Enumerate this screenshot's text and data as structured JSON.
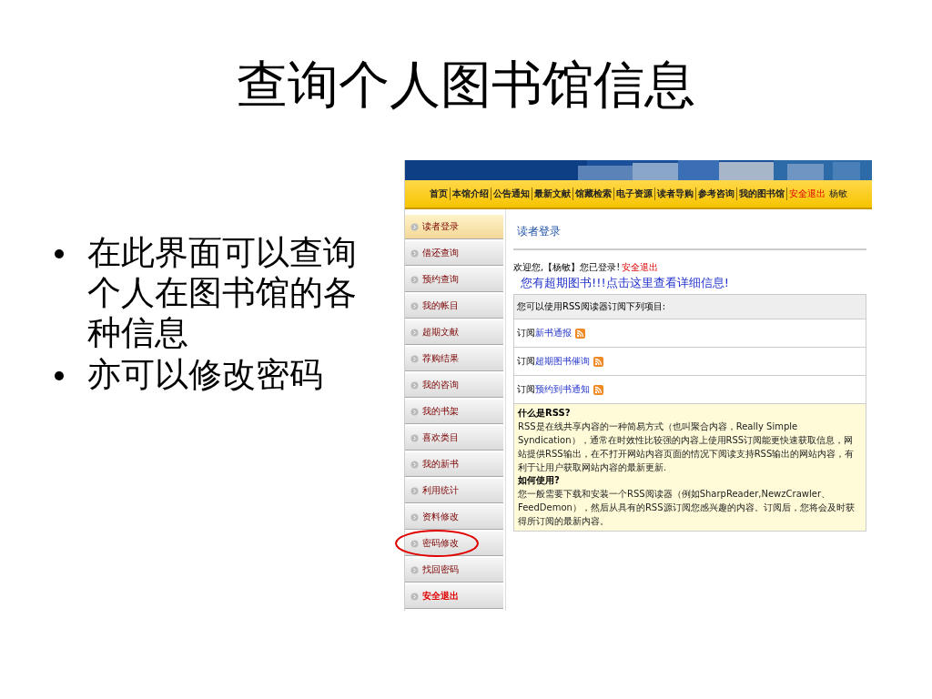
{
  "title": "查询个人图书馆信息",
  "bullets": [
    "在此界面可以查询个人在图书馆的各种信息",
    "亦可以修改密码"
  ],
  "screenshot": {
    "nav": [
      {
        "label": "首页",
        "kind": "link"
      },
      {
        "label": "本馆介绍",
        "kind": "link"
      },
      {
        "label": "公告通知",
        "kind": "link"
      },
      {
        "label": "最新文献",
        "kind": "link"
      },
      {
        "label": "馆藏检索",
        "kind": "link"
      },
      {
        "label": "电子资源",
        "kind": "link"
      },
      {
        "label": "读者导购",
        "kind": "link"
      },
      {
        "label": "参考咨询",
        "kind": "link"
      },
      {
        "label": "我的图书馆",
        "kind": "link"
      },
      {
        "label": "安全退出",
        "kind": "logout"
      },
      {
        "label": "杨敏",
        "kind": "user"
      }
    ],
    "sidebar": [
      {
        "label": "读者登录",
        "selected": true,
        "kind": "normal",
        "circled": false
      },
      {
        "label": "借还查询",
        "selected": false,
        "kind": "normal",
        "circled": false
      },
      {
        "label": "预约查询",
        "selected": false,
        "kind": "normal",
        "circled": false
      },
      {
        "label": "我的帐目",
        "selected": false,
        "kind": "normal",
        "circled": false
      },
      {
        "label": "超期文献",
        "selected": false,
        "kind": "normal",
        "circled": false
      },
      {
        "label": "荐购结果",
        "selected": false,
        "kind": "normal",
        "circled": false
      },
      {
        "label": "我的咨询",
        "selected": false,
        "kind": "normal",
        "circled": false
      },
      {
        "label": "我的书架",
        "selected": false,
        "kind": "normal",
        "circled": false
      },
      {
        "label": "喜欢类目",
        "selected": false,
        "kind": "normal",
        "circled": false
      },
      {
        "label": "我的新书",
        "selected": false,
        "kind": "normal",
        "circled": false
      },
      {
        "label": "利用统计",
        "selected": false,
        "kind": "normal",
        "circled": false
      },
      {
        "label": "资料修改",
        "selected": false,
        "kind": "normal",
        "circled": false
      },
      {
        "label": "密码修改",
        "selected": false,
        "kind": "normal",
        "circled": true
      },
      {
        "label": "找回密码",
        "selected": false,
        "kind": "normal",
        "circled": false
      },
      {
        "label": "安全退出",
        "selected": false,
        "kind": "logout",
        "circled": false
      }
    ],
    "heading": "读者登录",
    "welcome": {
      "text": "欢迎您,【杨敏】您已登录!",
      "logout": "安全退出"
    },
    "notice": "您有超期图书!!!点击这里查看详细信息!",
    "rss": {
      "intro": "您可以使用RSS阅读器订阅下列项目:",
      "items": [
        {
          "prefix": "订阅",
          "link": "新书通报"
        },
        {
          "prefix": "订阅",
          "link": "超期图书催询"
        },
        {
          "prefix": "订阅",
          "link": "预约到书通知"
        }
      ]
    },
    "help": [
      {
        "heading": "什么是RSS?",
        "body": "RSS是在线共享内容的一种简易方式（也叫聚合内容，Really Simple Syndication），通常在时效性比较强的内容上使用RSS订阅能更快速获取信息，网站提供RSS输出，在不打开网站内容页面的情况下阅读支持RSS输出的网站内容，有利于让用户获取网站内容的最新更新."
      },
      {
        "heading": "如何使用?",
        "body": "您一般需要下载和安装一个RSS阅读器（例如SharpReader,NewzCrawler、FeedDemon），然后从具有的RSS源订阅您感兴趣的内容。订阅后，您将会及时获得所订阅的最新内容。"
      }
    ]
  }
}
